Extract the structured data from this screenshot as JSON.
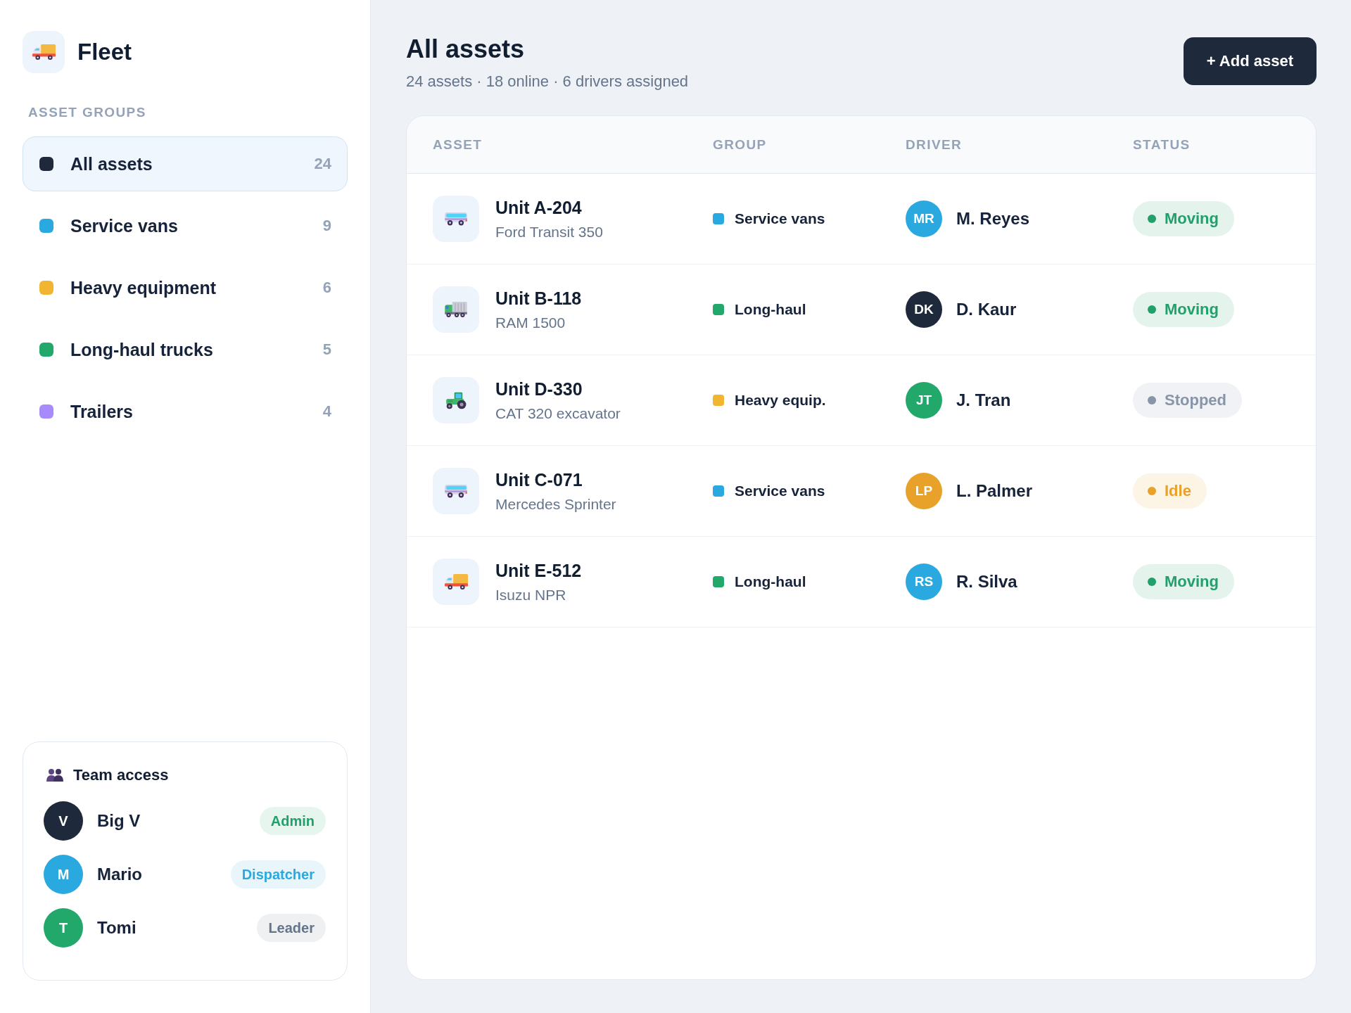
{
  "sidebar": {
    "brand": {
      "title": "Fleet"
    },
    "section_label": "ASSET GROUPS",
    "groups": [
      {
        "label": "All assets",
        "count": "24",
        "color": "#1e293b",
        "selected": true
      },
      {
        "label": "Service vans",
        "count": "9",
        "color": "#2aa9e0",
        "selected": false
      },
      {
        "label": "Heavy equipment",
        "count": "6",
        "color": "#f2b531",
        "selected": false
      },
      {
        "label": "Long-haul trucks",
        "count": "5",
        "color": "#22a86b",
        "selected": false
      },
      {
        "label": "Trailers",
        "count": "4",
        "color": "#a78bfa",
        "selected": false
      }
    ],
    "team_access": {
      "title": "Team access",
      "members": [
        {
          "initials": "V",
          "name": "Big V",
          "color": "#1e293b",
          "role": {
            "label": "Admin",
            "color": "#22a06b"
          }
        },
        {
          "initials": "M",
          "name": "Mario",
          "color": "#2aa9e0",
          "role": {
            "label": "Dispatcher",
            "color": "#2aa9e0"
          }
        },
        {
          "initials": "T",
          "name": "Tomi",
          "color": "#22a86b",
          "role": {
            "label": "Leader",
            "color": "#64748b"
          }
        }
      ]
    }
  },
  "header": {
    "title": "All assets",
    "subtitle": "24 assets · 18 online · 6 drivers assigned",
    "add_button": {
      "label": "+ Add asset"
    }
  },
  "table": {
    "columns": [
      "ASSET",
      "GROUP",
      "DRIVER",
      "STATUS"
    ],
    "rows": [
      {
        "kind": "van",
        "name": "Unit A-204",
        "model": "Ford Transit 350",
        "group": {
          "label": "Service vans",
          "color": "#2aa9e0"
        },
        "driver": {
          "initials": "MR",
          "name": "M. Reyes",
          "color": "#2aa9e0"
        },
        "status": {
          "label": "Moving",
          "color": "#22a06b"
        }
      },
      {
        "kind": "lorry",
        "name": "Unit B-118",
        "model": "RAM 1500",
        "group": {
          "label": "Long-haul",
          "color": "#22a86b"
        },
        "driver": {
          "initials": "DK",
          "name": "D. Kaur",
          "color": "#1e293b"
        },
        "status": {
          "label": "Moving",
          "color": "#22a06b"
        }
      },
      {
        "kind": "tractor",
        "name": "Unit D-330",
        "model": "CAT 320 excavator",
        "group": {
          "label": "Heavy equip.",
          "color": "#f2b531"
        },
        "driver": {
          "initials": "JT",
          "name": "J. Tran",
          "color": "#22a86b"
        },
        "status": {
          "label": "Stopped",
          "color": "#8894a8"
        }
      },
      {
        "kind": "van",
        "name": "Unit C-071",
        "model": "Mercedes Sprinter",
        "group": {
          "label": "Service vans",
          "color": "#2aa9e0"
        },
        "driver": {
          "initials": "LP",
          "name": "L. Palmer",
          "color": "#e8a22a"
        },
        "status": {
          "label": "Idle",
          "color": "#e8a22a"
        }
      },
      {
        "kind": "truck",
        "name": "Unit E-512",
        "model": "Isuzu NPR",
        "group": {
          "label": "Long-haul",
          "color": "#22a86b"
        },
        "driver": {
          "initials": "RS",
          "name": "R. Silva",
          "color": "#2aa9e0"
        },
        "status": {
          "label": "Moving",
          "color": "#22a06b"
        }
      }
    ]
  }
}
